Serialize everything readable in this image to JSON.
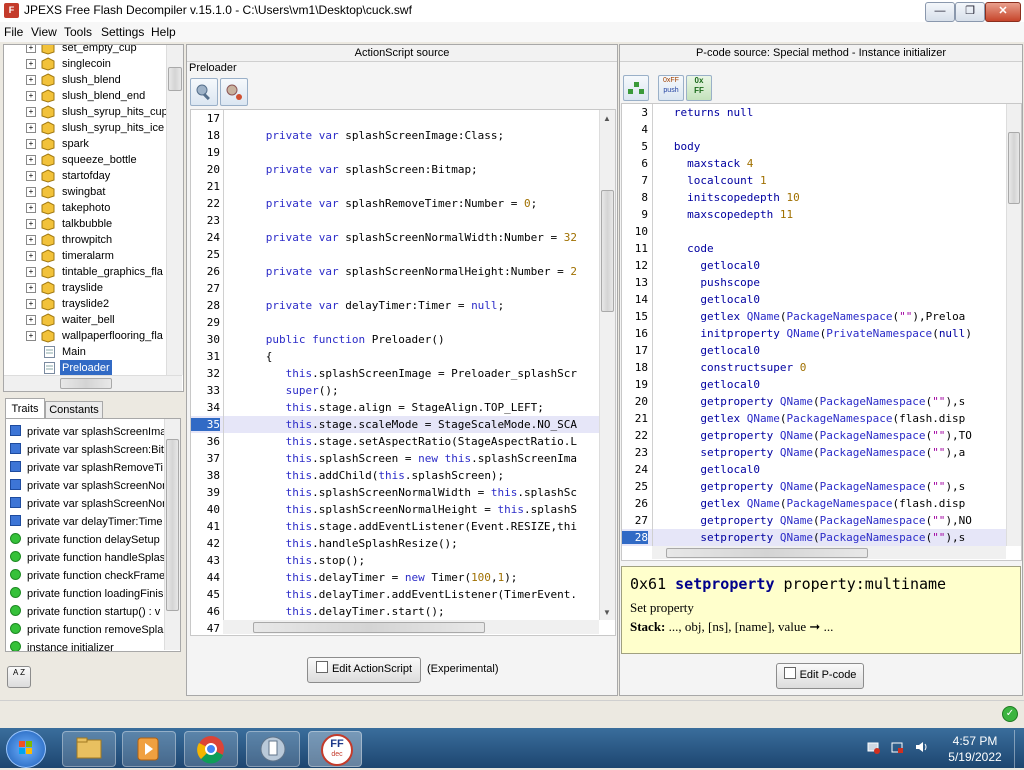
{
  "window": {
    "title": "JPEXS Free Flash Decompiler v.15.1.0 - C:\\Users\\vm1\\Desktop\\cuck.swf",
    "min_label": "—",
    "max_label": "❐",
    "close_label": "✕"
  },
  "menu": [
    "File",
    "View",
    "Tools",
    "Settings",
    "Help"
  ],
  "tree": {
    "items": [
      "set_empty_cup",
      "singlecoin",
      "slush_blend",
      "slush_blend_end",
      "slush_syrup_hits_cup",
      "slush_syrup_hits_ice",
      "spark",
      "squeeze_bottle",
      "startofday",
      "swingbat",
      "takephoto",
      "talkbubble",
      "throwpitch",
      "timeralarm",
      "tintable_graphics_fla",
      "trayslide",
      "trayslide2",
      "waiter_bell",
      "wallpaperflooring_fla"
    ],
    "classes": [
      "Main",
      "Preloader"
    ]
  },
  "traits": {
    "tabs": [
      "Traits",
      "Constants"
    ],
    "items": [
      {
        "kind": "var",
        "label": "private var splashScreenIma"
      },
      {
        "kind": "var",
        "label": "private var splashScreen:Bit"
      },
      {
        "kind": "var",
        "label": "private var splashRemoveTi"
      },
      {
        "kind": "var",
        "label": "private var splashScreenNor"
      },
      {
        "kind": "var",
        "label": "private var splashScreenNor"
      },
      {
        "kind": "var",
        "label": "private var delayTimer:Time"
      },
      {
        "kind": "fn",
        "label": "private function delaySetup"
      },
      {
        "kind": "fn",
        "label": "private function handleSplas"
      },
      {
        "kind": "fn",
        "label": "private function checkFrame"
      },
      {
        "kind": "fn",
        "label": "private function loadingFinis"
      },
      {
        "kind": "fn",
        "label": "private function startup() : v"
      },
      {
        "kind": "fn",
        "label": "private function removeSpla"
      },
      {
        "kind": "fn",
        "label": "instance initializer"
      }
    ],
    "sort_label": "A Z"
  },
  "as_panel": {
    "header": "ActionScript source",
    "class_name": "Preloader",
    "lines": [
      {
        "n": "17",
        "t": ""
      },
      {
        "n": "18",
        "t": "      private var splashScreenImage:Class;"
      },
      {
        "n": "19",
        "t": ""
      },
      {
        "n": "20",
        "t": "      private var splashScreen:Bitmap;"
      },
      {
        "n": "21",
        "t": ""
      },
      {
        "n": "22",
        "t": "      private var splashRemoveTimer:Number = 0;"
      },
      {
        "n": "23",
        "t": ""
      },
      {
        "n": "24",
        "t": "      private var splashScreenNormalWidth:Number = 32"
      },
      {
        "n": "25",
        "t": ""
      },
      {
        "n": "26",
        "t": "      private var splashScreenNormalHeight:Number = 2"
      },
      {
        "n": "27",
        "t": ""
      },
      {
        "n": "28",
        "t": "      private var delayTimer:Timer = null;"
      },
      {
        "n": "29",
        "t": ""
      },
      {
        "n": "30",
        "t": "      public function Preloader()"
      },
      {
        "n": "31",
        "t": "      {"
      },
      {
        "n": "32",
        "t": "         this.splashScreenImage = Preloader_splashScr"
      },
      {
        "n": "33",
        "t": "         super();"
      },
      {
        "n": "34",
        "t": "         this.stage.align = StageAlign.TOP_LEFT;"
      },
      {
        "n": "35",
        "t": "         this.stage.scaleMode = StageScaleMode.NO_SCA"
      },
      {
        "n": "36",
        "t": "         this.stage.setAspectRatio(StageAspectRatio.L"
      },
      {
        "n": "37",
        "t": "         this.splashScreen = new this.splashScreenIma"
      },
      {
        "n": "38",
        "t": "         this.addChild(this.splashScreen);"
      },
      {
        "n": "39",
        "t": "         this.splashScreenNormalWidth = this.splashSc"
      },
      {
        "n": "40",
        "t": "         this.splashScreenNormalHeight = this.splashS"
      },
      {
        "n": "41",
        "t": "         this.stage.addEventListener(Event.RESIZE,thi"
      },
      {
        "n": "42",
        "t": "         this.handleSplashResize();"
      },
      {
        "n": "43",
        "t": "         this.stop();"
      },
      {
        "n": "44",
        "t": "         this.delayTimer = new Timer(100,1);"
      },
      {
        "n": "45",
        "t": "         this.delayTimer.addEventListener(TimerEvent."
      },
      {
        "n": "46",
        "t": "         this.delayTimer.start();"
      },
      {
        "n": "47",
        "t": "      }"
      }
    ],
    "edit_label": "Edit ActionScript",
    "experimental_label": "(Experimental)"
  },
  "pcode_panel": {
    "header": "P-code source: Special method - Instance initializer",
    "push_label": "push",
    "hex_label": "0xFF",
    "hex_label2": "0x",
    "ff_label": "FF",
    "lines": [
      {
        "n": "3",
        "t": "   returns null"
      },
      {
        "n": "4",
        "t": ""
      },
      {
        "n": "5",
        "t": "   body"
      },
      {
        "n": "6",
        "t": "     maxstack 4"
      },
      {
        "n": "7",
        "t": "     localcount 1"
      },
      {
        "n": "8",
        "t": "     initscopedepth 10"
      },
      {
        "n": "9",
        "t": "     maxscopedepth 11"
      },
      {
        "n": "10",
        "t": ""
      },
      {
        "n": "11",
        "t": "     code"
      },
      {
        "n": "12",
        "t": "       getlocal0"
      },
      {
        "n": "13",
        "t": "       pushscope"
      },
      {
        "n": "14",
        "t": "       getlocal0"
      },
      {
        "n": "15",
        "t": "       getlex QName(PackageNamespace(\"\"),\"Preloa"
      },
      {
        "n": "16",
        "t": "       initproperty QName(PrivateNamespace(null)"
      },
      {
        "n": "17",
        "t": "       getlocal0"
      },
      {
        "n": "18",
        "t": "       constructsuper 0"
      },
      {
        "n": "19",
        "t": "       getlocal0"
      },
      {
        "n": "20",
        "t": "       getproperty QName(PackageNamespace(\"\"),\"s"
      },
      {
        "n": "21",
        "t": "       getlex QName(PackageNamespace(\"flash.disp"
      },
      {
        "n": "22",
        "t": "       getproperty QName(PackageNamespace(\"\"),\"TO"
      },
      {
        "n": "23",
        "t": "       setproperty QName(PackageNamespace(\"\"),\"a"
      },
      {
        "n": "24",
        "t": "       getlocal0"
      },
      {
        "n": "25",
        "t": "       getproperty QName(PackageNamespace(\"\"),\"s"
      },
      {
        "n": "26",
        "t": "       getlex QName(PackageNamespace(\"flash.disp"
      },
      {
        "n": "27",
        "t": "       getproperty QName(PackageNamespace(\"\"),\"NO"
      },
      {
        "n": "28",
        "t": "       setproperty QName(PackageNamespace(\"\"),\"s"
      }
    ],
    "doc_opcode": "0x61",
    "doc_name": "setproperty",
    "doc_arg": "property:multiname",
    "doc_desc": "Set property",
    "doc_stack_label": "Stack:",
    "doc_stack": "..., obj, [ns], [name], value ➞ ...",
    "edit_label": "Edit P-code"
  },
  "taskbar": {
    "time": "4:57 PM",
    "date": "5/19/2022",
    "ffdec_label": "FF",
    "ffdec_sub": "dec"
  },
  "colors": {
    "keyword": "#2c2cc8",
    "number": "#a07000",
    "accent": "#316ac5"
  }
}
